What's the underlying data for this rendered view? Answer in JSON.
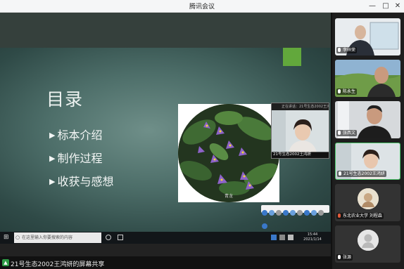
{
  "window": {
    "title": "腾讯会议",
    "controls": {
      "minimize": "—",
      "maximize": "□",
      "close": "✕"
    }
  },
  "slide": {
    "title": "目录",
    "toc": [
      "标本介绍",
      "制作过程",
      "收获与感想"
    ],
    "toc_bullet": "▶",
    "photo_caption": "青龙"
  },
  "floating_video": {
    "header": "正在讲话：21号生态2002王鸿妍",
    "name": "21号生态2002王鸿妍"
  },
  "taskbar": {
    "search_placeholder": "在这里输入你要搜索的内容",
    "time": "15:44",
    "date": "2021/1/14"
  },
  "status_bar": {
    "text": "21号生态2002王鸿妍的屏幕共享"
  },
  "participants": [
    {
      "name": "李祥荣",
      "video": true,
      "speaking": false
    },
    {
      "name": "陈永生",
      "video": true,
      "speaking": false
    },
    {
      "name": "张西文",
      "video": true,
      "speaking": false
    },
    {
      "name": "21号生态2002王鸿妍",
      "video": true,
      "speaking": true
    },
    {
      "name": "东北农业大学 刘程森",
      "video": false,
      "speaking": false
    },
    {
      "name": "张源",
      "video": false,
      "speaking": false
    }
  ],
  "colors": {
    "accent_green": "#4bc76a",
    "slide_green_square": "#62a83c",
    "sidebar_bg": "#1e1e1e"
  },
  "icons": [
    "microphone-icon",
    "search-icon",
    "windows-start-icon",
    "screen-share-icon",
    "user-avatar-icon"
  ]
}
